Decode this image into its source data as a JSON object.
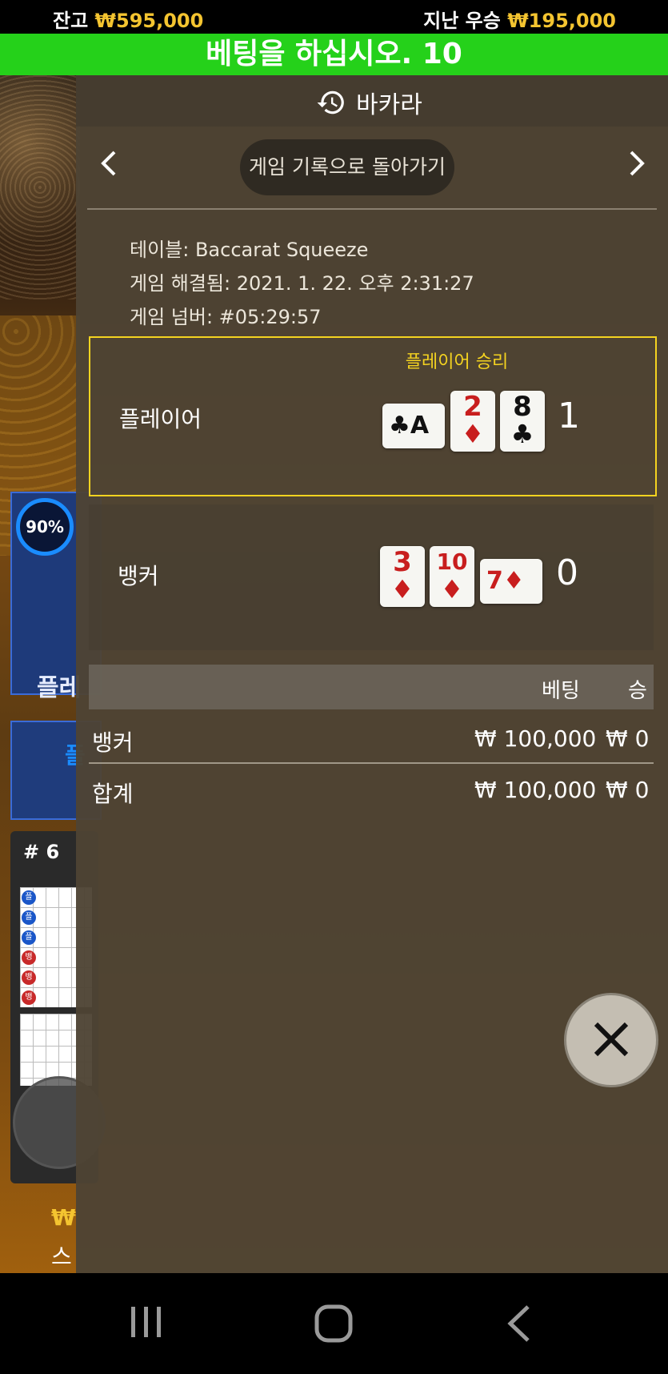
{
  "status": {
    "balance_label": "잔고",
    "balance_value": "₩595,000",
    "last_win_label": "지난 우승",
    "last_win_value": "₩195,000"
  },
  "banner": {
    "text": "베팅을 하십시오. 10"
  },
  "background": {
    "timer_percent": "90%",
    "player_label": "플레",
    "player_short": "플",
    "shoe_number": "# 6",
    "road_dots": [
      "플",
      "플",
      "플",
      "뱅",
      "뱅",
      "뱅"
    ],
    "bottom_amount": "₩",
    "bottom_name": "스"
  },
  "history": {
    "title": "바카라",
    "back_button": "게임 기록으로 돌아가기",
    "prev_icon": "chevron-left-icon",
    "next_icon": "chevron-right-icon",
    "table_label": "테이블: Baccarat Squeeze",
    "resolved_label": "게임 해결됨: 2021. 1. 22. 오후 2:31:27",
    "game_number_label": "게임 넘버: #05:29:57",
    "player": {
      "label": "플레이어",
      "win_text": "플레이어 승리",
      "score": "1",
      "cards": [
        {
          "rank": "A",
          "suit": "♣",
          "color": "black",
          "orientation": "side"
        },
        {
          "rank": "2",
          "suit": "♦",
          "color": "red",
          "orientation": "up"
        },
        {
          "rank": "8",
          "suit": "♣",
          "color": "black",
          "orientation": "up"
        }
      ]
    },
    "banker": {
      "label": "뱅커",
      "score": "0",
      "cards": [
        {
          "rank": "3",
          "suit": "♦",
          "color": "red",
          "orientation": "up"
        },
        {
          "rank": "10",
          "suit": "♦",
          "color": "red",
          "orientation": "up"
        },
        {
          "rank": "7",
          "suit": "♦",
          "color": "red",
          "orientation": "side"
        }
      ]
    },
    "bets_table": {
      "headers": [
        "베팅",
        "승"
      ],
      "rows": [
        {
          "name": "뱅커",
          "bet": "₩ 100,000",
          "win": "₩ 0"
        },
        {
          "name": "합계",
          "bet": "₩ 100,000",
          "win": "₩ 0"
        }
      ]
    }
  },
  "colors": {
    "accent_green": "#25d11a",
    "gold": "#f4c430",
    "win_border": "#f4d320"
  }
}
